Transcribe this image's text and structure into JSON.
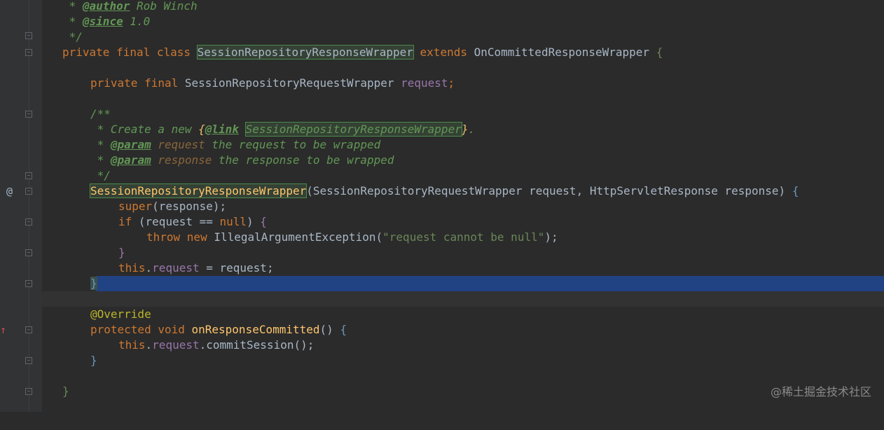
{
  "editor": {
    "lines": {
      "l0": {
        "t1": " * ",
        "t2": "@author",
        "t3": " Rob Winch"
      },
      "l1": {
        "t1": " * ",
        "t2": "@since",
        "t3": " 1.0"
      },
      "l2": {
        "t1": " */"
      },
      "l3": {
        "kw": "private final class ",
        "cls": "SessionRepositoryResponseWrapper",
        "kw2": " extends ",
        "base": "OnCommittedResponseWrapper ",
        "brace": "{"
      },
      "l5": {
        "kw": "private final ",
        "type": "SessionRepositoryRequestWrapper ",
        "field": "request",
        "semi": ";"
      },
      "l7": {
        "t1": "/**"
      },
      "l8": {
        "t1": " * Create a new ",
        "b1": "{",
        "link": "@link",
        "sp": " ",
        "ref": "SessionRepositoryResponseWrapper",
        "b2": "}",
        "dot": "."
      },
      "l9": {
        "t1": " * ",
        "tag": "@param",
        "name": " request",
        "desc": " the request to be wrapped"
      },
      "l10": {
        "t1": " * ",
        "tag": "@param",
        "name": " response",
        "desc": " the response to be wrapped"
      },
      "l11": {
        "t1": " */"
      },
      "l12": {
        "ctor": "SessionRepositoryResponseWrapper",
        "params": "(SessionRepositoryRequestWrapper request, HttpServletResponse response) ",
        "brace": "{"
      },
      "l13": {
        "kw": "super",
        "rest": "(response);"
      },
      "l14": {
        "kw": "if ",
        "p1": "(request == ",
        "kw2": "null",
        "p2": ") ",
        "brace": "{"
      },
      "l15": {
        "kw": "throw new ",
        "cls": "IllegalArgumentException",
        "p1": "(",
        "str": "\"request cannot be null\"",
        "p2": ");"
      },
      "l16": {
        "brace": "}"
      },
      "l17": {
        "kw": "this",
        "dot": ".",
        "field": "request",
        "rest": " = request;"
      },
      "l18": {
        "brace": "}"
      },
      "l20": {
        "ann": "@Override"
      },
      "l21": {
        "kw": "protected void ",
        "fn": "onResponseCommitted",
        "p": "() ",
        "brace": "{"
      },
      "l22": {
        "kw": "this",
        "dot": ".",
        "field": "request",
        "rest": ".commitSession();"
      },
      "l23": {
        "brace": "}"
      },
      "l25": {
        "brace": "}"
      }
    },
    "gutter": {
      "implements_icon": "@",
      "override_icon": "↑"
    }
  },
  "watermark": "@稀土掘金技术社区",
  "colors": {
    "background": "#2b2b2b",
    "keyword": "#cc7832",
    "doc_comment": "#629755",
    "string": "#6a8759",
    "field": "#9876aa",
    "annotation": "#bbb529",
    "selection": "#214283"
  }
}
